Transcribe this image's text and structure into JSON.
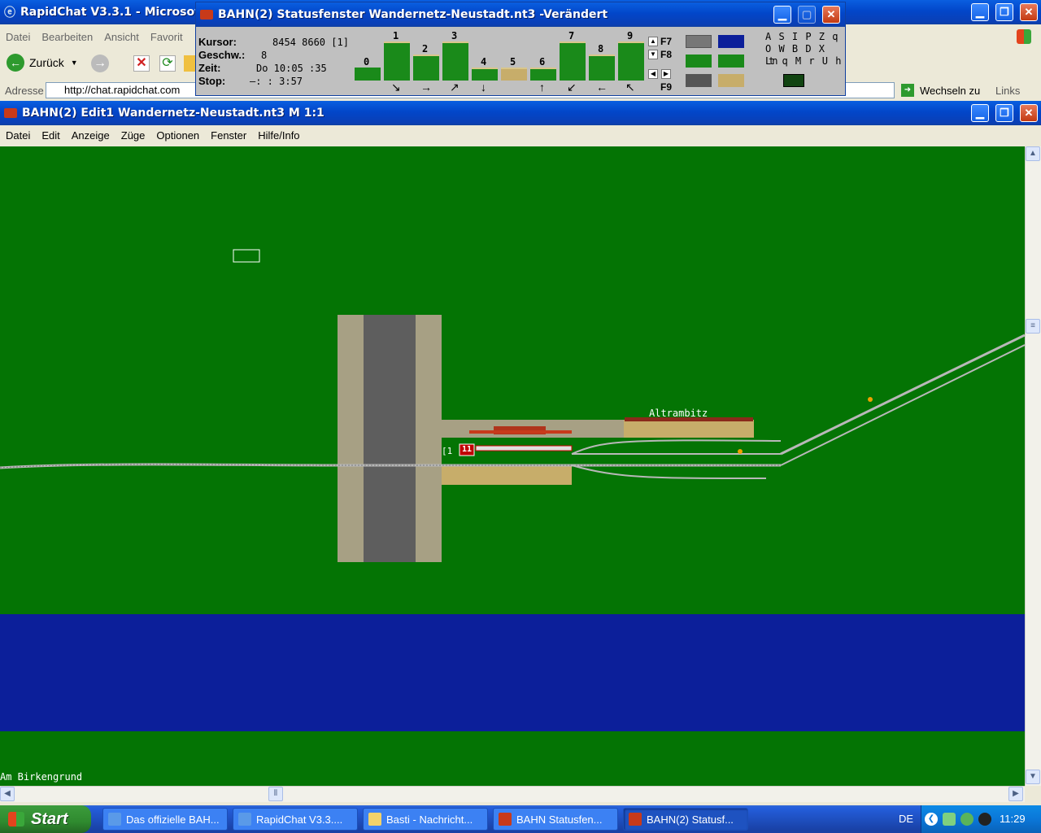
{
  "browser": {
    "title": "RapidChat V3.3.1 - Microsof",
    "menu": [
      "Datei",
      "Bearbeiten",
      "Ansicht",
      "Favorit"
    ],
    "back_label": "Zurück",
    "address_label": "Adresse",
    "address_value": "http://chat.rapidchat.com",
    "goto_label": "Wechseln zu",
    "links_label": "Links"
  },
  "status_window": {
    "title": "BAHN(2) Statusfenster Wandernetz-Neustadt.nt3 -Verändert",
    "kursor_label": "Kursor:",
    "kursor_value": "8454  8660 [1]",
    "geschw_label": "Geschw.:",
    "geschw_value": "8",
    "zeit_label": "Zeit:",
    "zeit_value": "Do   10:05 :35",
    "stop_label": "Stop:",
    "stop_value": "—:   : 3:57",
    "direction_numbers": [
      "0",
      "1",
      "2",
      "3",
      "4",
      "5",
      "6",
      "7",
      "8",
      "9"
    ],
    "arrows": [
      "↘",
      "→",
      "↗",
      "↓",
      "↑",
      "↙",
      "←",
      "↖"
    ],
    "fkeys": [
      "F7",
      "F8",
      "F9"
    ],
    "letters": [
      "A S I P Z q",
      "O W B D X Ln",
      "t q M r U h"
    ]
  },
  "editor": {
    "title": "BAHN(2) Edit1 Wandernetz-Neustadt.nt3 M 1:1",
    "menu": [
      "Datei",
      "Edit",
      "Anzeige",
      "Züge",
      "Optionen",
      "Fenster",
      "Hilfe/Info"
    ],
    "station_name": "Altrambitz",
    "train_tag": "[1",
    "train_number": "11",
    "place_name": "Am Birkengrund"
  },
  "taskbar": {
    "start_label": "Start",
    "tasks": [
      "Das offizielle BAH...",
      "RapidChat V3.3....",
      "Basti - Nachricht...",
      "BAHN Statusfen...",
      "BAHN(2) Statusf..."
    ],
    "lang": "DE",
    "time": "11:29"
  },
  "colors": {
    "grass": "#047404",
    "water": "#0c1f9a",
    "road": "#5e5e5e",
    "platform": "#c7ad6a",
    "xp_blue": "#0a4fd8"
  }
}
